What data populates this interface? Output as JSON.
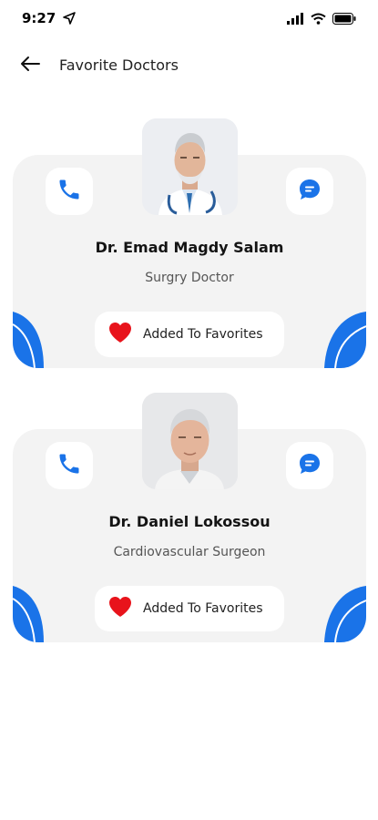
{
  "status_bar": {
    "time": "9:27"
  },
  "header": {
    "title": "Favorite Doctors"
  },
  "colors": {
    "accent": "#1A73E8",
    "heart": "#E8131B",
    "card_bg": "#F3F3F3"
  },
  "doctors": [
    {
      "name": "Dr. Emad Magdy Salam",
      "specialty": "Surgry Doctor",
      "favorite_label": "Added To Favorites",
      "photo": "doctor-photo-stethoscope",
      "call_icon": "phone-icon",
      "chat_icon": "chat-bubble-icon",
      "favorite_icon": "heart-icon"
    },
    {
      "name": "Dr. Daniel Lokossou",
      "specialty": "Cardiovascular Surgeon",
      "favorite_label": "Added To Favorites",
      "photo": "doctor-photo-senior",
      "call_icon": "phone-icon",
      "chat_icon": "chat-bubble-icon",
      "favorite_icon": "heart-icon"
    }
  ]
}
